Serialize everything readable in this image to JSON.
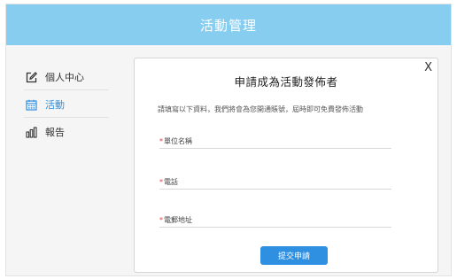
{
  "header": {
    "title": "活動管理"
  },
  "sidebar": {
    "items": [
      {
        "label": "個人中心",
        "icon": "edit-icon"
      },
      {
        "label": "活動",
        "icon": "calendar-icon"
      },
      {
        "label": "報告",
        "icon": "bar-chart-icon"
      }
    ],
    "active_color": "#2f8fe0"
  },
  "dialog": {
    "close_label": "X",
    "title": "申請成為活動發佈者",
    "description": "請填寫以下資料，我們將會為您開通賬號，屆時即可免費發佈活動",
    "fields": [
      {
        "required_mark": "*",
        "label": "單位名稱"
      },
      {
        "required_mark": "*",
        "label": "電話"
      },
      {
        "required_mark": "*",
        "label": "電郵地址"
      }
    ],
    "submit_label": "提交申請"
  },
  "colors": {
    "topbar": "#87cdf0",
    "primary": "#2f8fe0",
    "required": "#e23b3b"
  }
}
